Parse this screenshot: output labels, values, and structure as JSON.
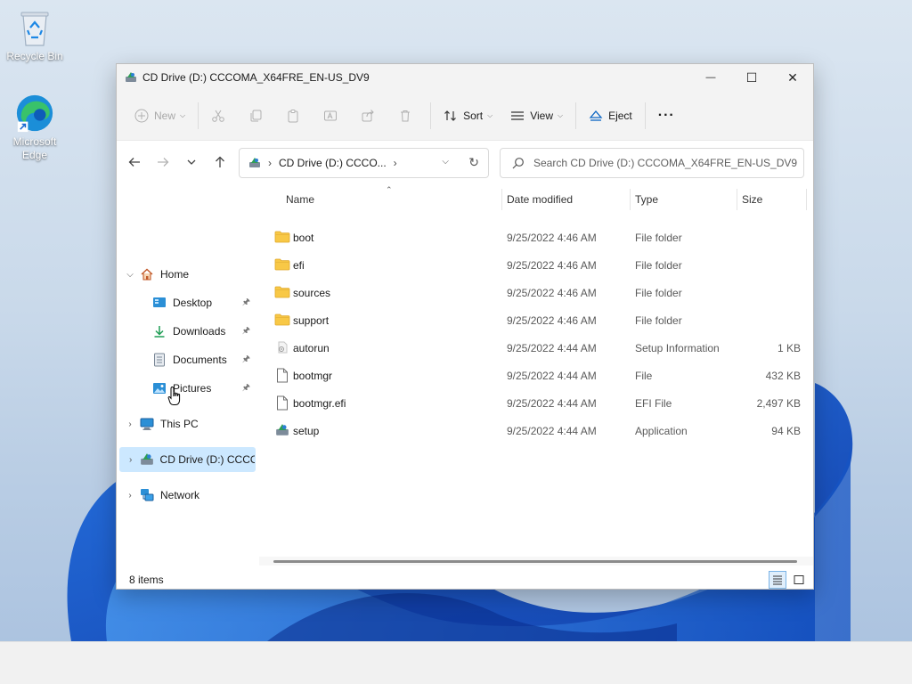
{
  "desktop": {
    "icons": [
      {
        "label": "Recycle Bin"
      },
      {
        "label": "Microsoft Edge"
      }
    ]
  },
  "window": {
    "title": "CD Drive (D:) CCCOMA_X64FRE_EN-US_DV9",
    "controls": {
      "minimize": "—",
      "maximize": "☐",
      "close": "✕"
    },
    "toolbar": {
      "new_label": "New",
      "sort_label": "Sort",
      "view_label": "View",
      "eject_label": "Eject",
      "more_label": "···"
    },
    "address": {
      "segment": "CD Drive (D:) CCCO...",
      "search_placeholder": "Search CD Drive (D:) CCCOMA_X64FRE_EN-US_DV9"
    },
    "sidebar": {
      "home": "Home",
      "quick": [
        {
          "label": "Desktop"
        },
        {
          "label": "Downloads"
        },
        {
          "label": "Documents"
        },
        {
          "label": "Pictures"
        }
      ],
      "this_pc": "This PC",
      "cd_drive": "CD Drive (D:) CCCO",
      "network": "Network"
    },
    "columns": {
      "name": "Name",
      "date": "Date modified",
      "type": "Type",
      "size": "Size"
    },
    "files": [
      {
        "name": "boot",
        "date": "9/25/2022 4:46 AM",
        "type": "File folder",
        "size": "",
        "icon": "folder-icon"
      },
      {
        "name": "efi",
        "date": "9/25/2022 4:46 AM",
        "type": "File folder",
        "size": "",
        "icon": "folder-icon"
      },
      {
        "name": "sources",
        "date": "9/25/2022 4:46 AM",
        "type": "File folder",
        "size": "",
        "icon": "folder-icon"
      },
      {
        "name": "support",
        "date": "9/25/2022 4:46 AM",
        "type": "File folder",
        "size": "",
        "icon": "folder-icon"
      },
      {
        "name": "autorun",
        "date": "9/25/2022 4:44 AM",
        "type": "Setup Information",
        "size": "1 KB",
        "icon": "setup-info-icon"
      },
      {
        "name": "bootmgr",
        "date": "9/25/2022 4:44 AM",
        "type": "File",
        "size": "432 KB",
        "icon": "file-icon"
      },
      {
        "name": "bootmgr.efi",
        "date": "9/25/2022 4:44 AM",
        "type": "EFI File",
        "size": "2,497 KB",
        "icon": "file-icon"
      },
      {
        "name": "setup",
        "date": "9/25/2022 4:44 AM",
        "type": "Application",
        "size": "94 KB",
        "icon": "setup-app-icon"
      }
    ],
    "status": {
      "count": "8 items"
    }
  },
  "colors": {
    "accent": "#0067c0",
    "folder": "#f8c846",
    "selection": "#cce8ff"
  }
}
